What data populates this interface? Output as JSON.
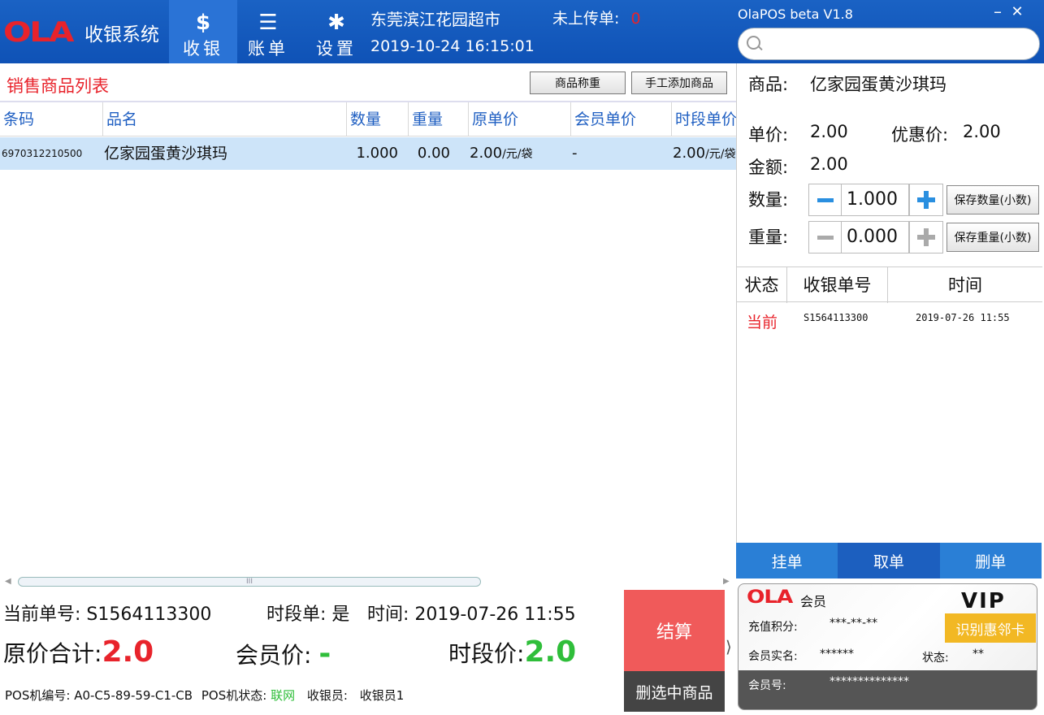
{
  "app": {
    "logo_text": "OLA",
    "system_name": "收银系统",
    "window_title": "OlaPOS beta V1.8",
    "minimize_glyph": "–",
    "close_glyph": "✕"
  },
  "nav": [
    {
      "icon": "$",
      "icon_name": "dollar-icon",
      "label": "收银",
      "active": true
    },
    {
      "icon": "☰",
      "icon_name": "list-icon",
      "label": "账单",
      "active": false
    },
    {
      "icon": "✱",
      "icon_name": "gear-icon",
      "label": "设置",
      "active": false
    }
  ],
  "header": {
    "store_name": "东莞滨江花园超市",
    "datetime": "2019-10-24 16:15:01",
    "unuploaded_label": "未上传单:",
    "unuploaded_count": "0"
  },
  "search": {
    "placeholder": ""
  },
  "product_list": {
    "title": "销售商品列表",
    "weigh_button": "商品称重",
    "manual_add_button": "手工添加商品",
    "columns": [
      "条码",
      "品名",
      "数量",
      "重量",
      "原单价",
      "会员单价",
      "时段单价"
    ],
    "rows": [
      {
        "barcode": "6970312210500",
        "name": "亿家园蛋黄沙琪玛",
        "qty": "1.000",
        "weight": "0.00",
        "price": "2.00",
        "price_unit": "/元/袋",
        "member_price": "-",
        "period_price": "2.00",
        "period_unit": "/元/袋"
      }
    ],
    "scroll_grip": "III"
  },
  "summary": {
    "order_no_label": "当前单号:",
    "order_no": "S1564113300",
    "period_order_label": "时段单:",
    "period_order_value": "是",
    "time_label": "时间:",
    "time_value": "2019-07-26 11:55",
    "original_total_label": "原价合计:",
    "original_total": "2.0",
    "member_price_label": "会员价:",
    "member_price_value": "-",
    "period_price_label": "时段价:",
    "period_price_value": "2.0",
    "pos_no_label": "POS机编号:",
    "pos_no": "A0-C5-89-59-C1-CB",
    "pos_status_label": "POS机状态:",
    "pos_status": "联网",
    "cashier_label": "收银员:",
    "cashier": "收银员1",
    "checkout_button": "结算",
    "delete_selected_button": "删选中商品",
    "collapse_glyph": "⟩"
  },
  "detail": {
    "product_label": "商品:",
    "product_name": "亿家园蛋黄沙琪玛",
    "unit_price_label": "单价:",
    "unit_price": "2.00",
    "discount_label": "优惠价:",
    "discount_price": "2.00",
    "amount_label": "金额:",
    "amount": "2.00",
    "qty_label": "数量:",
    "qty": "1.000",
    "save_qty_button": "保存数量(小数)",
    "weight_label": "重量:",
    "weight": "0.000",
    "save_weight_button": "保存重量(小数)"
  },
  "orders": {
    "columns": [
      "状态",
      "收银单号",
      "时间"
    ],
    "rows": [
      {
        "status": "当前",
        "order_no": "S1564113300",
        "time": "2019-07-26 11:55"
      }
    ]
  },
  "actions": [
    {
      "label": "挂单",
      "color": "#2a7fd6"
    },
    {
      "label": "取单",
      "color": "#1c5fbf"
    },
    {
      "label": "删单",
      "color": "#2a7fd6"
    }
  ],
  "member": {
    "logo_text": "OLA",
    "title": "会员",
    "vip": "VIP",
    "points_label": "充值积分:",
    "points": "***-**-**",
    "recognize_button": "识别惠邻卡",
    "realname_label": "会员实名:",
    "realname": "******",
    "status_label": "状态:",
    "status": "**",
    "member_no_label": "会员号:",
    "member_no": "**************"
  },
  "colors": {
    "header_blue": "#1158bd",
    "accent_red": "#e8232b",
    "accent_green": "#2fbe3a",
    "row_select": "#cde4f9",
    "checkout_red": "#f05a5a"
  }
}
